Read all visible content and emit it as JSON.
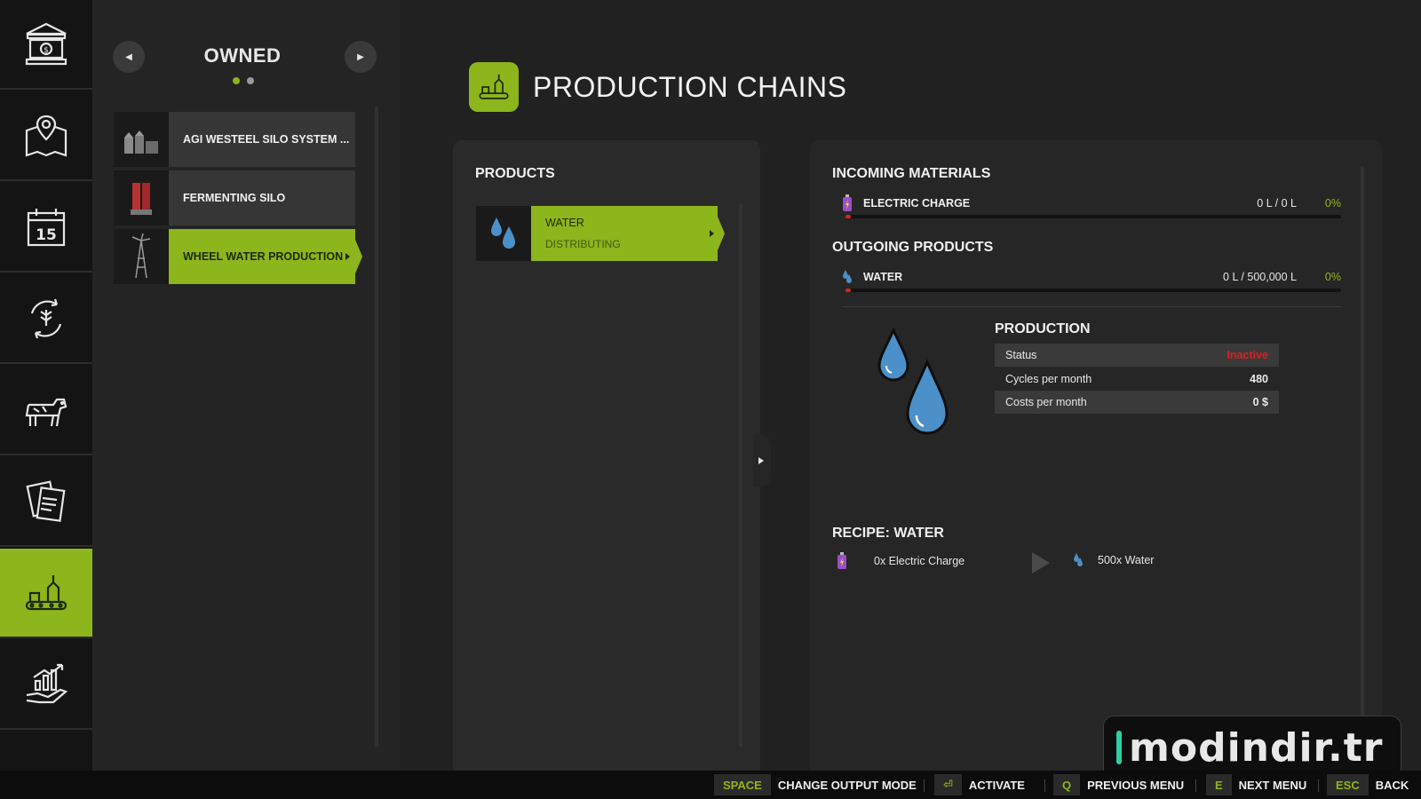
{
  "colors": {
    "accent": "#8db51c",
    "warning": "#e02020",
    "water": "#4b90c8"
  },
  "sidebar": {
    "items": [
      {
        "icon": "bank-icon"
      },
      {
        "icon": "map-icon"
      },
      {
        "icon": "calendar-icon",
        "badge": "15"
      },
      {
        "icon": "cycle-icon"
      },
      {
        "icon": "cow-icon"
      },
      {
        "icon": "contracts-icon"
      },
      {
        "icon": "production-icon",
        "active": true
      },
      {
        "icon": "finance-icon"
      }
    ]
  },
  "owned": {
    "title": "OWNED",
    "items": [
      {
        "label": "AGI WESTEEL SILO SYSTEM ...",
        "icon": "silo-system-icon"
      },
      {
        "label": "FERMENTING SILO",
        "icon": "fermenting-silo-icon"
      },
      {
        "label": "WHEEL WATER PRODUCTION",
        "icon": "windmill-icon",
        "active": true
      }
    ]
  },
  "page": {
    "title": "PRODUCTION CHAINS"
  },
  "products": {
    "header": "PRODUCTS",
    "items": [
      {
        "name": "WATER",
        "status": "DISTRIBUTING"
      }
    ]
  },
  "details": {
    "incoming_header": "INCOMING MATERIALS",
    "incoming": [
      {
        "name": "ELECTRIC CHARGE",
        "amount": "0 L / 0 L",
        "percent": "0%"
      }
    ],
    "outgoing_header": "OUTGOING PRODUCTS",
    "outgoing": [
      {
        "name": "WATER",
        "amount": "0 L / 500,000 L",
        "percent": "0%"
      }
    ],
    "production_header": "PRODUCTION",
    "stats": [
      {
        "label": "Status",
        "value": "Inactive"
      },
      {
        "label": "Cycles per month",
        "value": "480"
      },
      {
        "label": "Costs per month",
        "value": "0 $"
      }
    ],
    "recipe_header": "RECIPE: WATER",
    "recipe": {
      "input": "0x Electric Charge",
      "output": "500x Water"
    }
  },
  "watermark": "modindir.tr",
  "hints": [
    {
      "key": "SPACE",
      "label": "CHANGE OUTPUT MODE"
    },
    {
      "key": "⏎",
      "label": "ACTIVATE"
    },
    {
      "key": "Q",
      "label": "PREVIOUS MENU"
    },
    {
      "key": "E",
      "label": "NEXT MENU"
    },
    {
      "key": "ESC",
      "label": "BACK"
    }
  ]
}
